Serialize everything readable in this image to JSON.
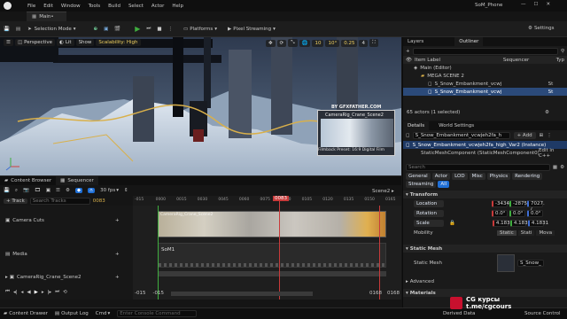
{
  "titlebar": {
    "menu": [
      "File",
      "Edit",
      "Window",
      "Tools",
      "Build",
      "Select",
      "Actor",
      "Help"
    ],
    "project": "SoM_Phone",
    "tab": "Main•"
  },
  "toolbar": {
    "mode": "Selection Mode",
    "platforms": "Platforms",
    "pixel_streaming": "Pixel Streaming",
    "settings": "Settings"
  },
  "viewport": {
    "perspective": "Perspective",
    "lit": "Lit",
    "show": "Show",
    "scalability": "Scalability: High",
    "snap_grid": "10",
    "snap_rot": "10°",
    "snap_scale": "0.25",
    "cam_speed": "4",
    "pip_title": "CameraRig_Crane_Scene2",
    "pip_sub": "Filmback Preset: 16:9 Digital Film",
    "pip_watermark": "BY GFXFATHER.COM"
  },
  "outliner": {
    "tabs": [
      "Layers",
      "Outliner"
    ],
    "col_label": "Item Label",
    "col_seq": "Sequencer",
    "col_type": "Typ",
    "items": [
      {
        "label": "Main (Editor)",
        "type": ""
      },
      {
        "label": "MEGA SCENE 2",
        "type": ""
      },
      {
        "label": "S_Snow_Embankment_vcwj",
        "type": "St"
      },
      {
        "label": "S_Snow_Embankment_vcwj",
        "type": "St"
      }
    ],
    "status": "65 actors (1 selected)"
  },
  "details": {
    "tabs": [
      "Details",
      "World Settings"
    ],
    "actor_name": "S_Snow_Embankment_vcwjeh2fa_h",
    "add": "+ Add",
    "instance": "S_Snow_Embankment_vcwjeh2fa_high_Var2 (Instance)",
    "component": "StaticMeshComponent (StaticMeshComponent0)",
    "component_edit": "Edit in C++",
    "search_placeholder": "Search",
    "filters": [
      "General",
      "Actor",
      "LOD",
      "Misc",
      "Physics",
      "Rendering"
    ],
    "filters2": [
      "Streaming",
      "All"
    ],
    "transform_header": "Transform",
    "location_label": "Location",
    "location": [
      "-3434",
      "-2875",
      "7027.("
    ],
    "rotation_label": "Rotation",
    "rotation": [
      "0.0°",
      "0.0°",
      "0.0°"
    ],
    "scale_label": "Scale",
    "scale": [
      "4.1831",
      "4.1831",
      "4.1831"
    ],
    "mobility_label": "Mobility",
    "mobility": [
      "Static",
      "Stati",
      "Mova"
    ],
    "static_mesh_header": "Static Mesh",
    "static_mesh_label": "Static Mesh",
    "static_mesh_value": "S_Snow_",
    "advanced": "Advanced",
    "materials": "Materials"
  },
  "sequencer": {
    "tabs": [
      "Content Browser",
      "Sequencer"
    ],
    "track_btn": "+ Track",
    "search_placeholder": "Search Tracks",
    "frame_field": "0083",
    "fps": "30 fps",
    "scene": "Scene2",
    "playhead": "0083",
    "ruler": [
      "-015",
      "0000",
      "0015",
      "0030",
      "0045",
      "0060",
      "0075",
      "0090",
      "0105",
      "0120",
      "0135",
      "0150",
      "0165"
    ],
    "tracks": [
      "Camera Cuts",
      "Media",
      "CameraRig_Crane_Scene2"
    ],
    "clip1": "CameraRig_Crane_Scene2",
    "clip2": "SoM1",
    "in_frames": [
      "-015",
      "-015"
    ],
    "out_frames": [
      "0168",
      "0168"
    ]
  },
  "bottombar": {
    "content_drawer": "Content Drawer",
    "output_log": "Output Log",
    "cmd": "Cmd",
    "console_placeholder": "Enter Console Command",
    "derived": "Derived Data",
    "source": "Source Control",
    "watermark": "CG курсы",
    "watermark_link": "t.me/cgcours"
  },
  "colors": {
    "accent_blue": "#1f6fd6",
    "play_green": "#3fae3f",
    "playhead_red": "#c83a3a",
    "selection": "#2b4a7a"
  }
}
